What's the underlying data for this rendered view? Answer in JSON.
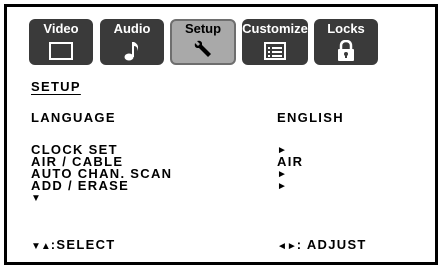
{
  "tabs": [
    {
      "label": "Video",
      "icon": "monitor-icon",
      "active": false
    },
    {
      "label": "Audio",
      "icon": "music-note-icon",
      "active": false
    },
    {
      "label": "Setup",
      "icon": "wrench-icon",
      "active": true
    },
    {
      "label": "Customize",
      "icon": "list-icon",
      "active": false
    },
    {
      "label": "Locks",
      "icon": "lock-icon",
      "active": false
    }
  ],
  "menu": {
    "title": "SETUP",
    "items": [
      {
        "label": "LANGUAGE",
        "value": "ENGLISH"
      },
      {
        "label": "CLOCK SET",
        "value": "►"
      },
      {
        "label": "AIR / CABLE",
        "value": "AIR"
      },
      {
        "label": "AUTO CHAN. SCAN",
        "value": "►"
      },
      {
        "label": "ADD / ERASE",
        "value": "►"
      }
    ],
    "more_indicator": "▼"
  },
  "footer": {
    "select_keys": "▼▲",
    "select_label": ":SELECT",
    "adjust_keys": "◄►",
    "adjust_label": ": ADJUST"
  }
}
